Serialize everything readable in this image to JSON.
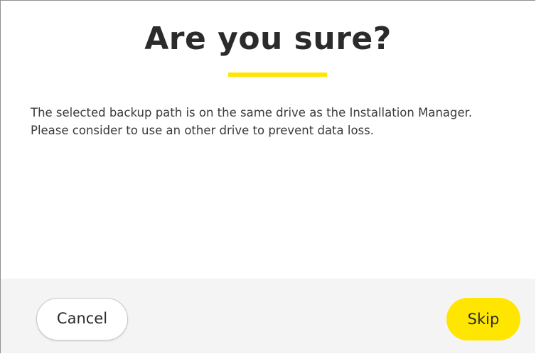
{
  "dialog": {
    "title": "Are you sure?",
    "message_lines": [
      "The selected backup path is on the same drive as the Installation Manager.",
      "Please consider to use an other drive to prevent data loss."
    ]
  },
  "buttons": {
    "cancel_label": "Cancel",
    "skip_label": "Skip"
  },
  "colors": {
    "accent": "#ffe600",
    "text": "#2b2b2b",
    "footer_bg": "#f4f4f4"
  }
}
